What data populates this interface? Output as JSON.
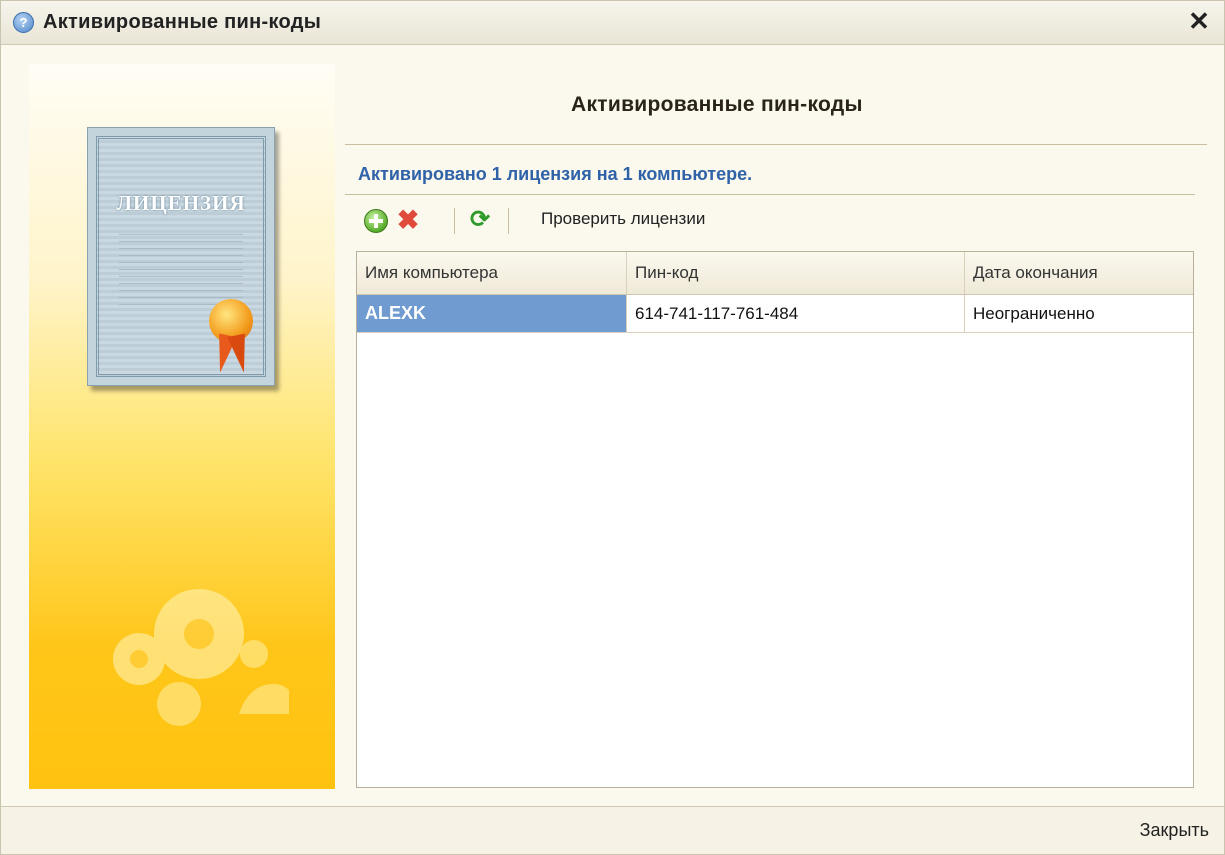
{
  "window": {
    "title": "Активированные пин-коды",
    "close_glyph": "✕",
    "help_glyph": "?"
  },
  "left_panel": {
    "certificate_title": "ЛИЦЕНЗИЯ"
  },
  "content": {
    "title": "Активированные пин-коды",
    "status": "Активировано 1 лицензия на 1 компьютере."
  },
  "toolbar": {
    "add_icon": "add-icon",
    "delete_icon": "delete-icon",
    "delete_glyph": "✖",
    "refresh_icon": "refresh-icon",
    "refresh_glyph": "⟳",
    "check_label": "Проверить лицензии"
  },
  "grid": {
    "columns": [
      "Имя компьютера",
      "Пин-код",
      "Дата окончания"
    ],
    "rows": [
      {
        "computer": "ALEXK",
        "pin": "614-741-117-761-484",
        "expires": "Неограниченно",
        "selected": true
      }
    ]
  },
  "footer": {
    "close_label": "Закрыть"
  },
  "colors": {
    "selection": "#6f9bd0",
    "status_text": "#2f62a8",
    "panel_yellow": "#ffc20f"
  }
}
